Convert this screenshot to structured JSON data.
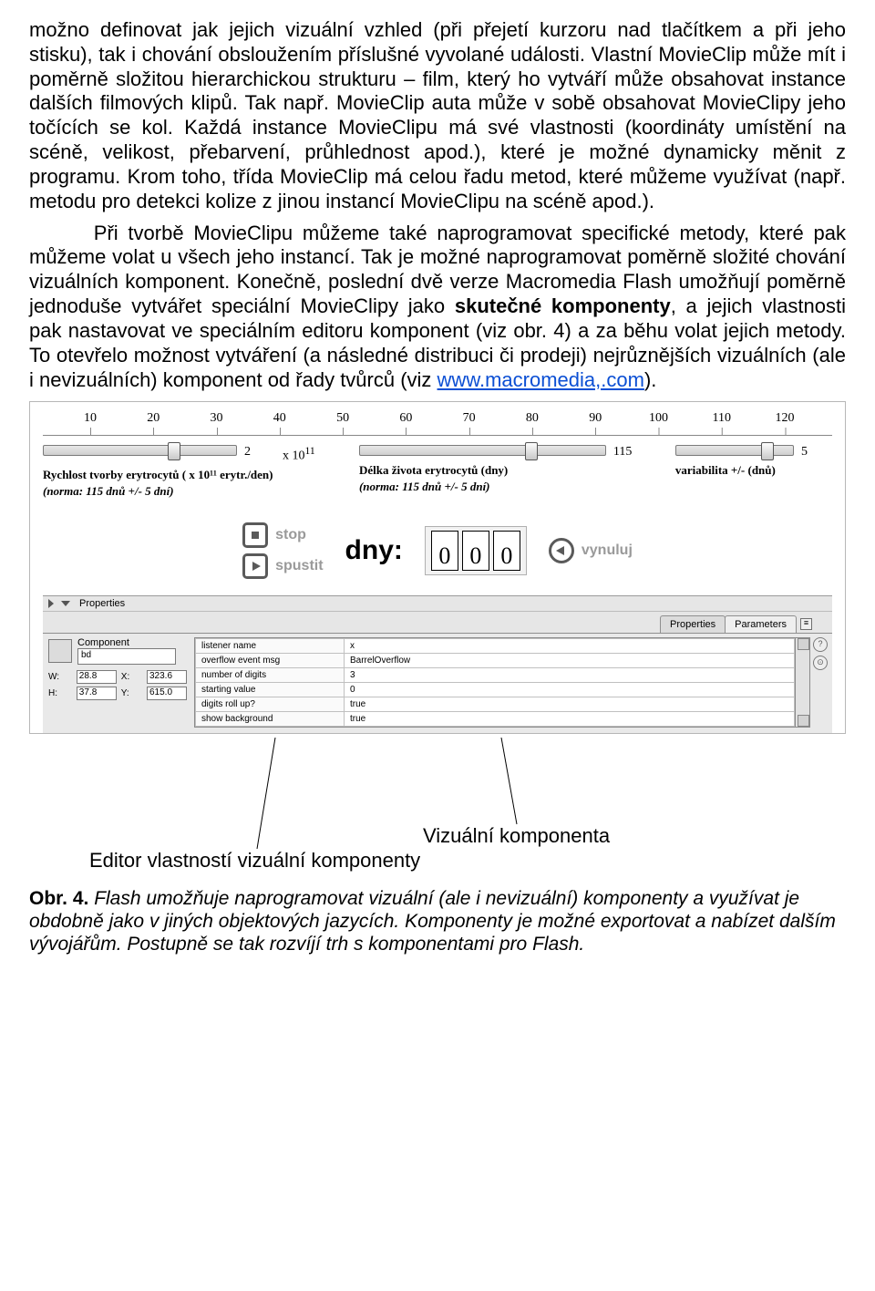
{
  "para1": "možno definovat jak jejich vizuální vzhled (při přejetí kurzoru nad tlačítkem a při jeho stisku), tak i chování obsloužením příslušné vyvolané události. Vlastní MovieClip může mít i poměrně složitou hierarchickou strukturu – film, který ho vytváří může obsahovat instance dalších filmových klipů. Tak např. MovieClip auta může v sobě obsahovat MovieClipy jeho točících se kol. Každá instance MovieClipu má své vlastnosti (koordináty umístění na scéně, velikost, přebarvení, průhlednost apod.), které je možné dynamicky měnit z programu. Krom toho, třída MovieClip má celou řadu metod, které můžeme využívat (např. metodu pro detekci kolize z jinou instancí MovieClipu na scéně apod.).",
  "para2a": "Při tvorbě MovieClipu můžeme také  naprogramovat specifické metody, které pak můžeme volat u všech jeho instancí. Tak je možné naprogramovat poměrně složité chování vizuálních komponent. Konečně, poslední dvě verze Macromedia Flash umožňují poměrně jednoduše vytvářet speciální MovieClipy jako ",
  "para2bold": "skutečné komponenty",
  "para2b": ", a jejich vlastnosti pak nastavovat ve speciálním editoru komponent (viz obr. 4) a za běhu volat jejich metody. To otevřelo možnost vytváření (a následné distribuci či prodeji) nejrůznějších vizuálních (ale i nevizuálních) komponent od řady tvůrců (viz ",
  "link": "www.macromedia,.com",
  "para2c": ").",
  "ruler": [
    "10",
    "20",
    "30",
    "40",
    "50",
    "60",
    "70",
    "80",
    "90",
    "100",
    "110",
    "120"
  ],
  "slider1": {
    "value": "2",
    "exp": "x 10",
    "expSup": "11",
    "label1": "Rychlost tvorby erytrocytů ( x 10¹¹ erytr./den)",
    "label2": "(norma: 115 dnů  +/-  5 dní)"
  },
  "slider2": {
    "value": "115",
    "label1": "Délka života erytrocytů (dny)",
    "label2": "(norma: 115 dnů  +/-  5 dní)"
  },
  "slider3": {
    "value": "5",
    "label1": "variabilita +/- (dnů)"
  },
  "btnStop": "stop",
  "btnPlay": "spustit",
  "dnyLabel": "dny:",
  "odometer": [
    "0",
    "0",
    "0"
  ],
  "btnReset": "vynuluj",
  "inspector": {
    "tabProperties": "Properties",
    "tabParameters": "Parameters",
    "compLabel": "Component",
    "compName": "bd",
    "W": "W:",
    "Wv": "28.8",
    "X": "X:",
    "Xv": "323.6",
    "H": "H:",
    "Hv": "37.8",
    "Y": "Y:",
    "Yv": "615.0",
    "rows": [
      [
        "listener name",
        "x"
      ],
      [
        "overflow event msg",
        "BarrelOverflow"
      ],
      [
        "number of digits",
        "3"
      ],
      [
        "starting value",
        "0"
      ],
      [
        "digits roll up?",
        "true"
      ],
      [
        "show background",
        "true"
      ]
    ]
  },
  "callout1": "Vizuální komponenta",
  "callout2": "Editor vlastností vizuální komponenty",
  "captionBold": "Obr. 4.",
  "caption": " Flash umožňuje naprogramovat vizuální (ale i nevizuální) komponenty a využívat je obdobně jako v jiných objektových jazycích. Komponenty je možné exportovat a nabízet dalším vývojářům. Postupně se tak rozvíjí trh s komponentami pro Flash."
}
